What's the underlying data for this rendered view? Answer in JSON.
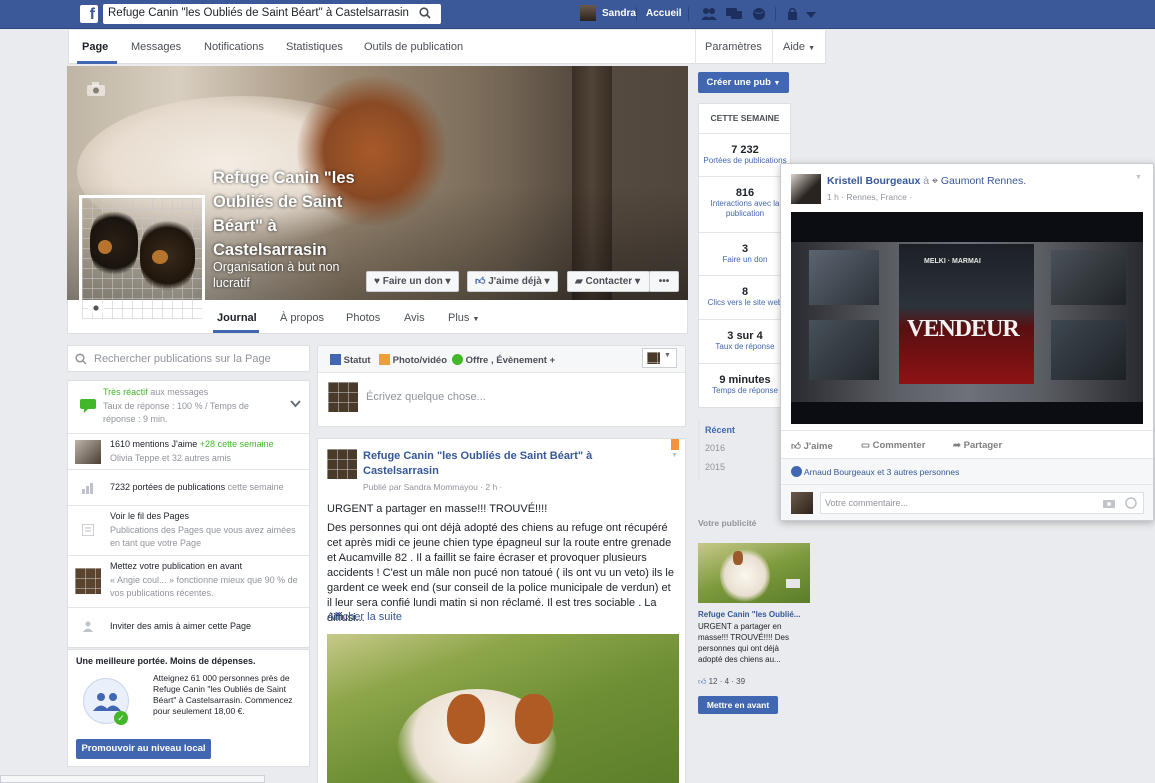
{
  "topbar": {
    "search_value": "Refuge Canin \"les Oubliés de Saint Béart\" à Castelsarrasin",
    "user_name": "Sandra",
    "home": "Accueil"
  },
  "nav": {
    "tabs": [
      "Page",
      "Messages",
      "Notifications",
      "Statistiques",
      "Outils de publication"
    ],
    "settings": "Paramètres",
    "help": "Aide"
  },
  "cover": {
    "page_name": "Refuge Canin \"les Oubliés de Saint Béart\" à Castelsarrasin",
    "category": "Organisation à but non lucratif",
    "donate": "Faire un don",
    "like": "J'aime déjà",
    "contact": "Contacter",
    "more": "•••"
  },
  "page_tabs": [
    "Journal",
    "À propos",
    "Photos",
    "Avis",
    "Plus"
  ],
  "left": {
    "search_placeholder": "Rechercher publications sur la Page",
    "response": {
      "title": "Très réactif",
      "title_rest": "aux messages",
      "detail": "Taux de réponse : 100 % / Temps de réponse : 9 min."
    },
    "likes": {
      "text": "1610 mentions J'aime",
      "new": "+28 cette semaine",
      "sub": "Olivia Teppe et 32 autres amis"
    },
    "reach": {
      "text": "7232 portées de publications",
      "sub": "cette semaine"
    },
    "feed": {
      "title": "Voir le fil des Pages",
      "sub": "Publications des Pages que vous avez aimées en tant que votre Page"
    },
    "boost_tip": {
      "title": "Mettez votre publication en avant",
      "sub": "« Angie coul... » fonctionne mieux que 90 % de vos publications récentes."
    },
    "invite": "Inviter des amis à aimer cette Page",
    "promo": {
      "title": "Une meilleure portée. Moins de dépenses.",
      "text": "Atteignez 61 000 personnes près de Refuge Canin \"les Oubliés de Saint Béart\" à Castelsarrasin. Commencez pour seulement 18,00 €.",
      "button": "Promouvoir au niveau local"
    }
  },
  "composer": {
    "status": "Statut",
    "photo": "Photo/vidéo",
    "offer": "Offre , Évènement +",
    "placeholder": "Écrivez quelque chose..."
  },
  "post": {
    "page_name": "Refuge Canin \"les Oubliés de Saint Béart\" à Castelsarrasin",
    "meta": "Publié par Sandra Mommayou · 2 h ·",
    "line1": "URGENT a partager en masse!!! TROUVÉ!!!!",
    "body": "Des personnes qui ont déjà adopté des chiens au refuge ont récupéré cet après midi ce jeune chien type épagneul sur la route entre grenade et Aucamville 82 . Il a faillit se faire écraser et provoquer plusieurs accidents ! C'est un mâle non pucé non tatoué ( ils ont vu un veto) ils le gardent ce week end (sur conseil de la police municipale de verdun) et il leur sera confié lundi matin si non réclamé. Il est tres sociable . La diffusi...",
    "more": "Afficher la suite"
  },
  "right": {
    "create_ad": "Créer une pub",
    "week_title": "CETTE SEMAINE",
    "stats": [
      {
        "value": "7 232",
        "label": "Portées de publications"
      },
      {
        "value": "816",
        "label": "Interactions avec la publication"
      },
      {
        "value": "3",
        "label": "Faire un don"
      },
      {
        "value": "8",
        "label": "Clics vers le site web"
      },
      {
        "value": "3 sur 4",
        "label": "Taux de réponse"
      },
      {
        "value": "9 minutes",
        "label": "Temps de réponse"
      }
    ],
    "years": [
      "Récent",
      "2016",
      "2015"
    ],
    "ad_title": "Votre publicité",
    "ad_name": "Refuge Canin \"les Oublié...",
    "ad_text": "URGENT a partager en masse!!! TROUVÉ!!!! Des personnes qui ont déjà adopté des chiens au...",
    "ad_stats": "12 · 4 · 39",
    "ad_button": "Mettre en avant"
  },
  "popup": {
    "author": "Kristell Bourgeaux",
    "at": "à",
    "place": "Gaumont Rennes.",
    "meta": "1 h · Rennes, France ·",
    "poster_title": "VENDEUR",
    "poster_names": "MELKI · MARMAI",
    "like": "J'aime",
    "comment": "Commenter",
    "share": "Partager",
    "likers": "Arnaud Bourgeaux et 3 autres personnes",
    "comment_placeholder": "Votre commentaire..."
  },
  "colors": {
    "brand": "#3b5998",
    "accent": "#4267b2",
    "bg": "#e9ebee"
  }
}
